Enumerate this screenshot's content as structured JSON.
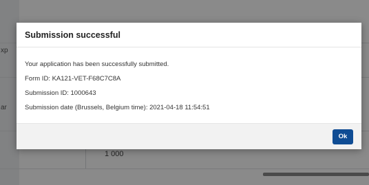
{
  "background": {
    "left_texts": [
      "xp",
      "ar"
    ],
    "cell_value": "1 000"
  },
  "dialog": {
    "title": "Submission successful",
    "message": "Your application has been successfully submitted.",
    "form_id": "Form ID: KA121-VET-F68C7C8A",
    "submission_id": "Submission ID: 1000643",
    "submission_date": "Submission date (Brussels, Belgium time): 2021-04-18 11:54:51",
    "ok_label": "Ok"
  },
  "colors": {
    "primary_button": "#0f4c94",
    "overlay": "rgba(0,0,0,0.46)"
  }
}
